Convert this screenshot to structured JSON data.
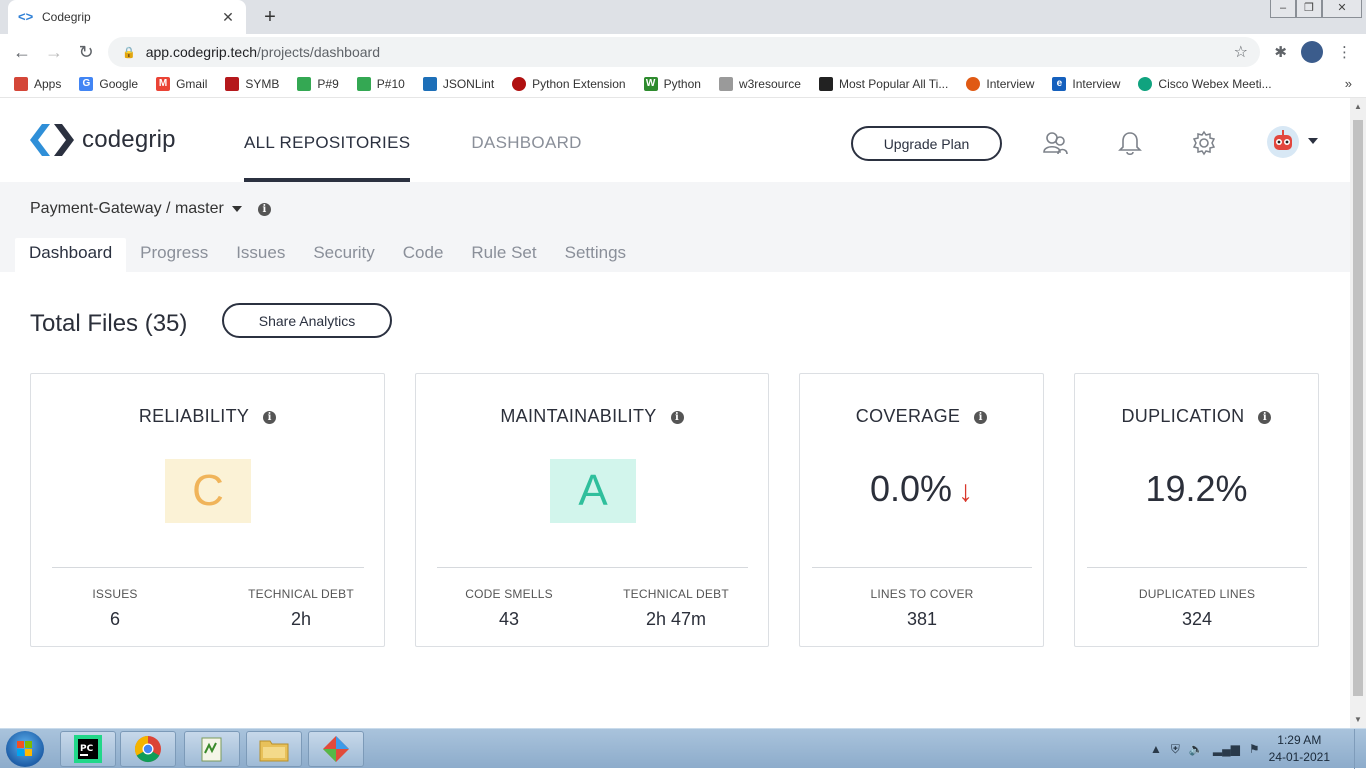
{
  "browser": {
    "tab_title": "Codegrip",
    "url_host": "app.codegrip.tech",
    "url_path": "/projects/dashboard",
    "bookmarks": [
      {
        "label": "Apps",
        "color": "#d44638"
      },
      {
        "label": "Google",
        "color": "#4285f4"
      },
      {
        "label": "Gmail",
        "color": "#ea4335"
      },
      {
        "label": "SYMB",
        "color": "#b5181c"
      },
      {
        "label": "P#9",
        "color": "#34a853"
      },
      {
        "label": "P#10",
        "color": "#34a853"
      },
      {
        "label": "JSONLint",
        "color": "#1d6fb8"
      },
      {
        "label": "Python Extension",
        "color": "#b01010"
      },
      {
        "label": "Python",
        "color": "#2e8b2e"
      },
      {
        "label": "w3resource",
        "color": "#9a9a9a"
      },
      {
        "label": "Most Popular All Ti...",
        "color": "#222222"
      },
      {
        "label": "Interview",
        "color": "#e05a14"
      },
      {
        "label": "Interview",
        "color": "#1560bd"
      },
      {
        "label": "Cisco Webex Meeti...",
        "color": "#10a37f"
      }
    ]
  },
  "app": {
    "logo_text": "codegrip",
    "nav": [
      {
        "label": "ALL REPOSITORIES",
        "active": true
      },
      {
        "label": "DASHBOARD",
        "active": false
      }
    ],
    "upgrade_label": "Upgrade Plan"
  },
  "project": {
    "branch": "Payment-Gateway / master",
    "tabs": [
      "Dashboard",
      "Progress",
      "Issues",
      "Security",
      "Code",
      "Rule Set",
      "Settings"
    ],
    "active_tab": "Dashboard"
  },
  "summary": {
    "total_files": "Total Files (35)",
    "share_label": "Share Analytics"
  },
  "cards": {
    "reliability": {
      "title": "RELIABILITY",
      "grade": "C",
      "grade_color": "#f0b45a",
      "grade_bg": "#fbf2d6",
      "m1_label": "ISSUES",
      "m1_value": "6",
      "m2_label": "TECHNICAL DEBT",
      "m2_value": "2h"
    },
    "maintainability": {
      "title": "MAINTAINABILITY",
      "grade": "A",
      "grade_color": "#2fbf9c",
      "grade_bg": "#d2f5ec",
      "m1_label": "CODE SMELLS",
      "m1_value": "43",
      "m2_label": "TECHNICAL DEBT",
      "m2_value": "2h 47m"
    },
    "coverage": {
      "title": "COVERAGE",
      "value": "0.0%",
      "trend": "↓",
      "m1_label": "LINES TO COVER",
      "m1_value": "381"
    },
    "duplication": {
      "title": "DUPLICATION",
      "value": "19.2%",
      "m1_label": "DUPLICATED LINES",
      "m1_value": "324"
    }
  },
  "taskbar": {
    "time": "1:29 AM",
    "date": "24-01-2021"
  }
}
